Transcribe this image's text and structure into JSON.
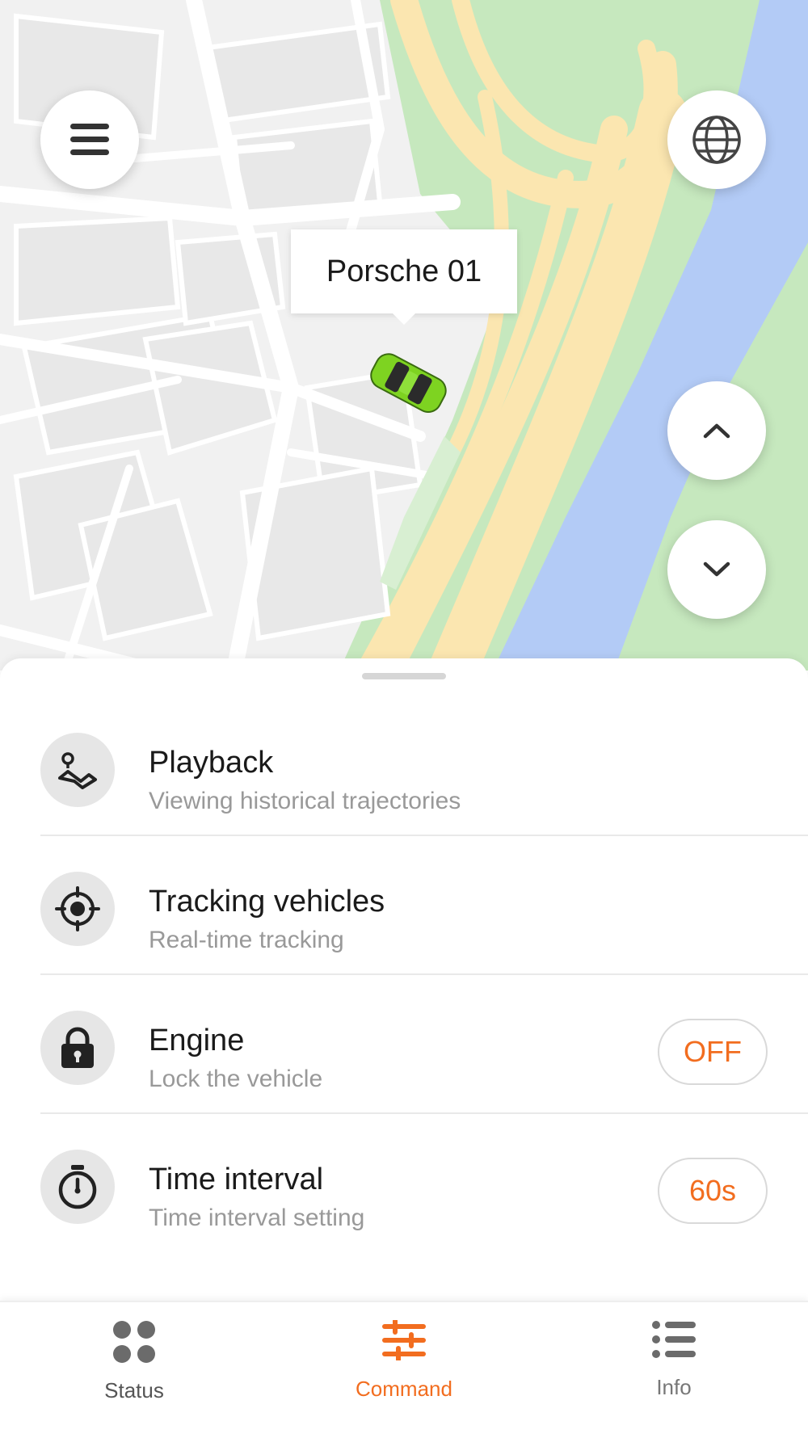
{
  "map": {
    "vehicle_label": "Porsche 01",
    "colors": {
      "park": "#c6e8be",
      "water": "#b3cbf6",
      "highway": "#fbe6b0",
      "road": "#ffffff",
      "land": "#f1f1f1"
    },
    "icons": [
      "menu-icon",
      "globe-icon",
      "chevron-up-icon",
      "chevron-down-icon",
      "car-icon"
    ]
  },
  "commands": [
    {
      "title": "Playback",
      "subtitle": "Viewing historical trajectories",
      "icon": "route-icon"
    },
    {
      "title": "Tracking vehicles",
      "subtitle": "Real-time tracking",
      "icon": "crosshair-icon"
    },
    {
      "title": "Engine",
      "subtitle": "Lock the vehicle",
      "icon": "lock-icon",
      "action": "OFF"
    },
    {
      "title": "Time interval",
      "subtitle": "Time interval setting",
      "icon": "stopwatch-icon",
      "action": "60s"
    }
  ],
  "tabs": [
    {
      "label": "Status",
      "icon": "grid-icon",
      "active": false
    },
    {
      "label": "Command",
      "icon": "sliders-icon",
      "active": true
    },
    {
      "label": "Info",
      "icon": "list-icon",
      "active": false
    }
  ],
  "accent_color": "#f26d1f"
}
